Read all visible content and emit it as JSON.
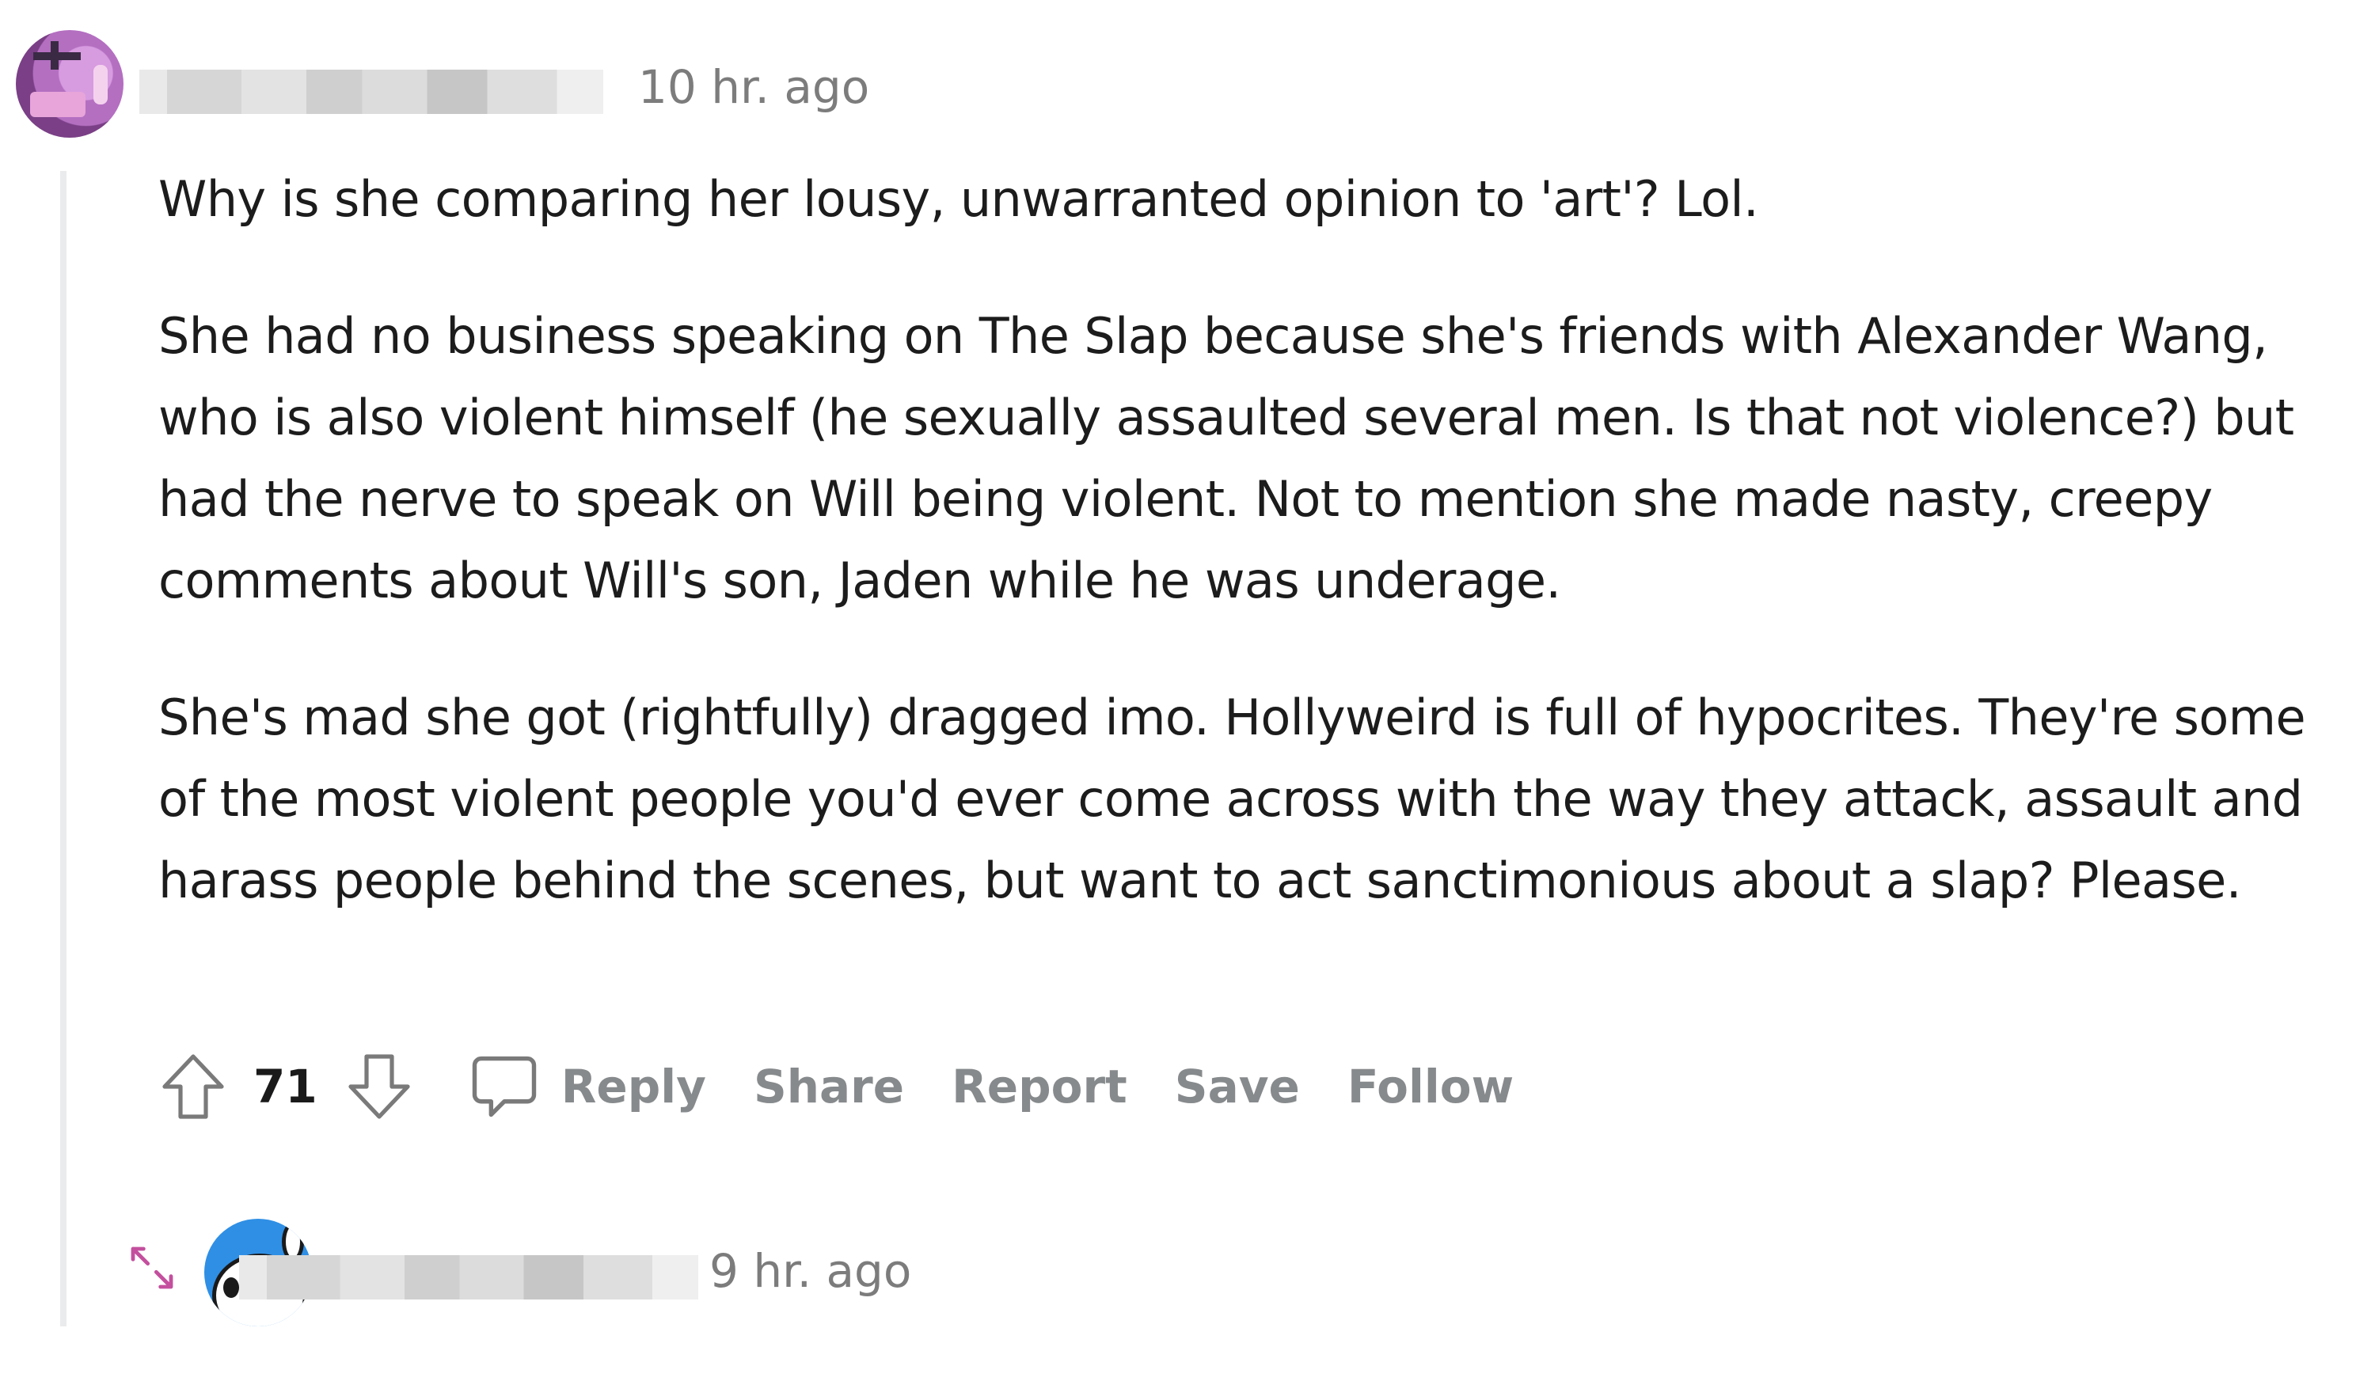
{
  "comment": {
    "username_blurred": true,
    "time": "10 hr. ago",
    "paragraphs": [
      "Why is she comparing her lousy, unwarranted opinion to 'art'? Lol.",
      "She had no business speaking on The Slap because she's friends with Alexander Wang, who is also violent himself (he sexually assaulted several men. Is that not violence?) but had the nerve to speak on Will being violent. Not to mention she made nasty, creepy comments about Will's son, Jaden while he was underage.",
      "She's mad she got (rightfully) dragged imo. Hollyweird is full of hypocrites. They're some of the most violent people you'd ever come across with the way they attack, assault and harass people behind the scenes, but want to act sanctimonious about a slap? Please."
    ],
    "votes": "71",
    "actions": {
      "reply": "Reply",
      "share": "Share",
      "report": "Report",
      "save": "Save",
      "follow": "Follow"
    },
    "icons": {
      "upvote": "upvote-icon",
      "downvote": "downvote-icon",
      "comment": "comment-bubble-icon"
    }
  },
  "reply_comment": {
    "username_blurred": true,
    "time": "9 hr. ago",
    "icons": {
      "expand": "expand-icon"
    }
  },
  "colors": {
    "meta_text": "#7c7c7c",
    "action_text": "#878a8c",
    "thread_line": "#eaebec",
    "expand_icon": "#c44f9e"
  }
}
